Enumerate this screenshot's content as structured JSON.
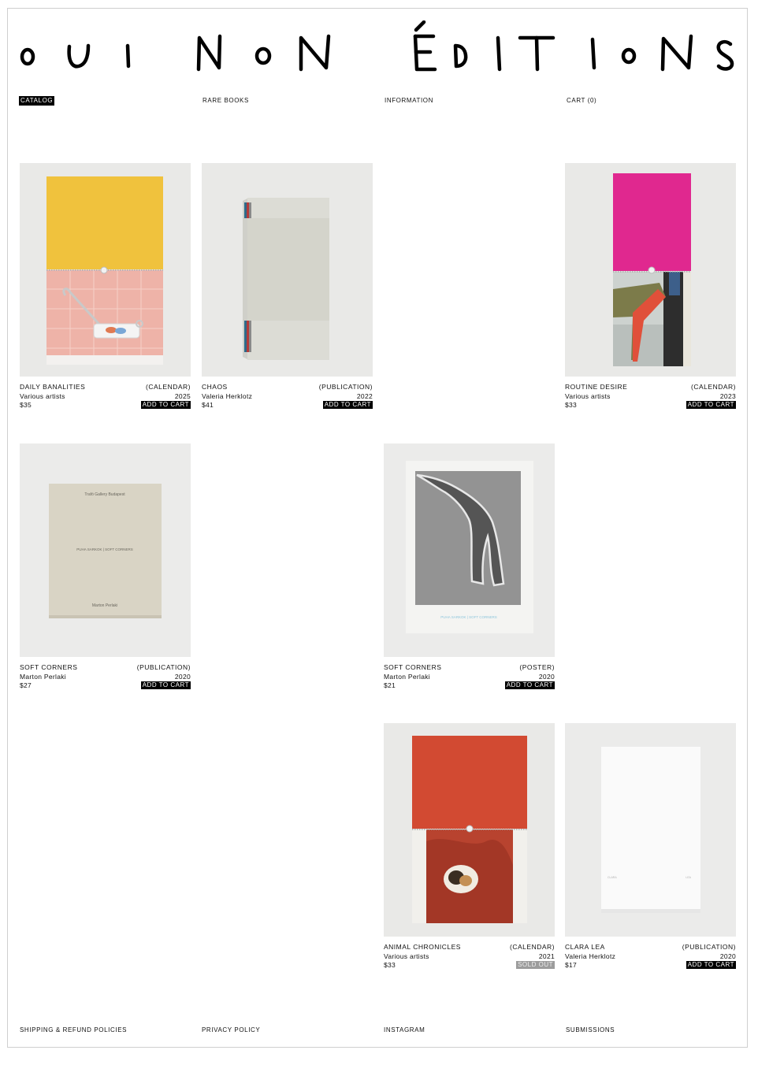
{
  "brand": {
    "name": "OUI NON ÉDITIONS"
  },
  "nav": {
    "catalog": "CATALOG",
    "rare_books": "RARE BOOKS",
    "information": "INFORMATION",
    "cart": "CART (0)"
  },
  "products": [
    {
      "title": "DAILY BANALITIES",
      "artist": "Various artists",
      "type": "(CALENDAR)",
      "year": "2025",
      "price": "$35",
      "action": "ADD TO CART"
    },
    {
      "title": "CHAOS",
      "artist": "Valeria Herklotz",
      "type": "(PUBLICATION)",
      "year": "2022",
      "price": "$41",
      "action": "ADD TO CART"
    },
    {
      "title": "ROUTINE DESIRE",
      "artist": "Various artists",
      "type": "(CALENDAR)",
      "year": "2023",
      "price": "$33",
      "action": "ADD TO CART"
    },
    {
      "title": "SOFT CORNERS",
      "artist": "Marton Perlaki",
      "type": "(PUBLICATION)",
      "year": "2020",
      "price": "$27",
      "action": "ADD TO CART",
      "cover": {
        "top": "Trafó Gallery Budapest",
        "middle": "PUHA SARKOK | SOFT CORNERS",
        "bottom": "Marton Perlaki"
      }
    },
    {
      "title": "SOFT CORNERS",
      "artist": "Marton Perlaki",
      "type": "(POSTER)",
      "year": "2020",
      "price": "$21",
      "action": "ADD TO CART",
      "cover": {
        "caption": "PUHA SARKOK | SOFT CORNERS"
      }
    },
    {
      "title": "ANIMAL CHRONICLES",
      "artist": "Various artists",
      "type": "(CALENDAR)",
      "year": "2021",
      "price": "$33",
      "action": "SOLD OUT"
    },
    {
      "title": "CLARA LEA",
      "artist": "Valeria Herklotz",
      "type": "(PUBLICATION)",
      "year": "2020",
      "price": "$17",
      "action": "ADD TO CART",
      "cover": {
        "left": "CLARA",
        "right": "LEA"
      }
    }
  ],
  "footer": {
    "shipping": "SHIPPING & REFUND POLICIES",
    "privacy": "PRIVACY POLICY",
    "instagram": "INSTAGRAM",
    "submissions": "SUBMISSIONS"
  },
  "colors": {
    "accent": "#000000",
    "sold_out": "#9c9c9c",
    "image_background": "#ececec"
  }
}
